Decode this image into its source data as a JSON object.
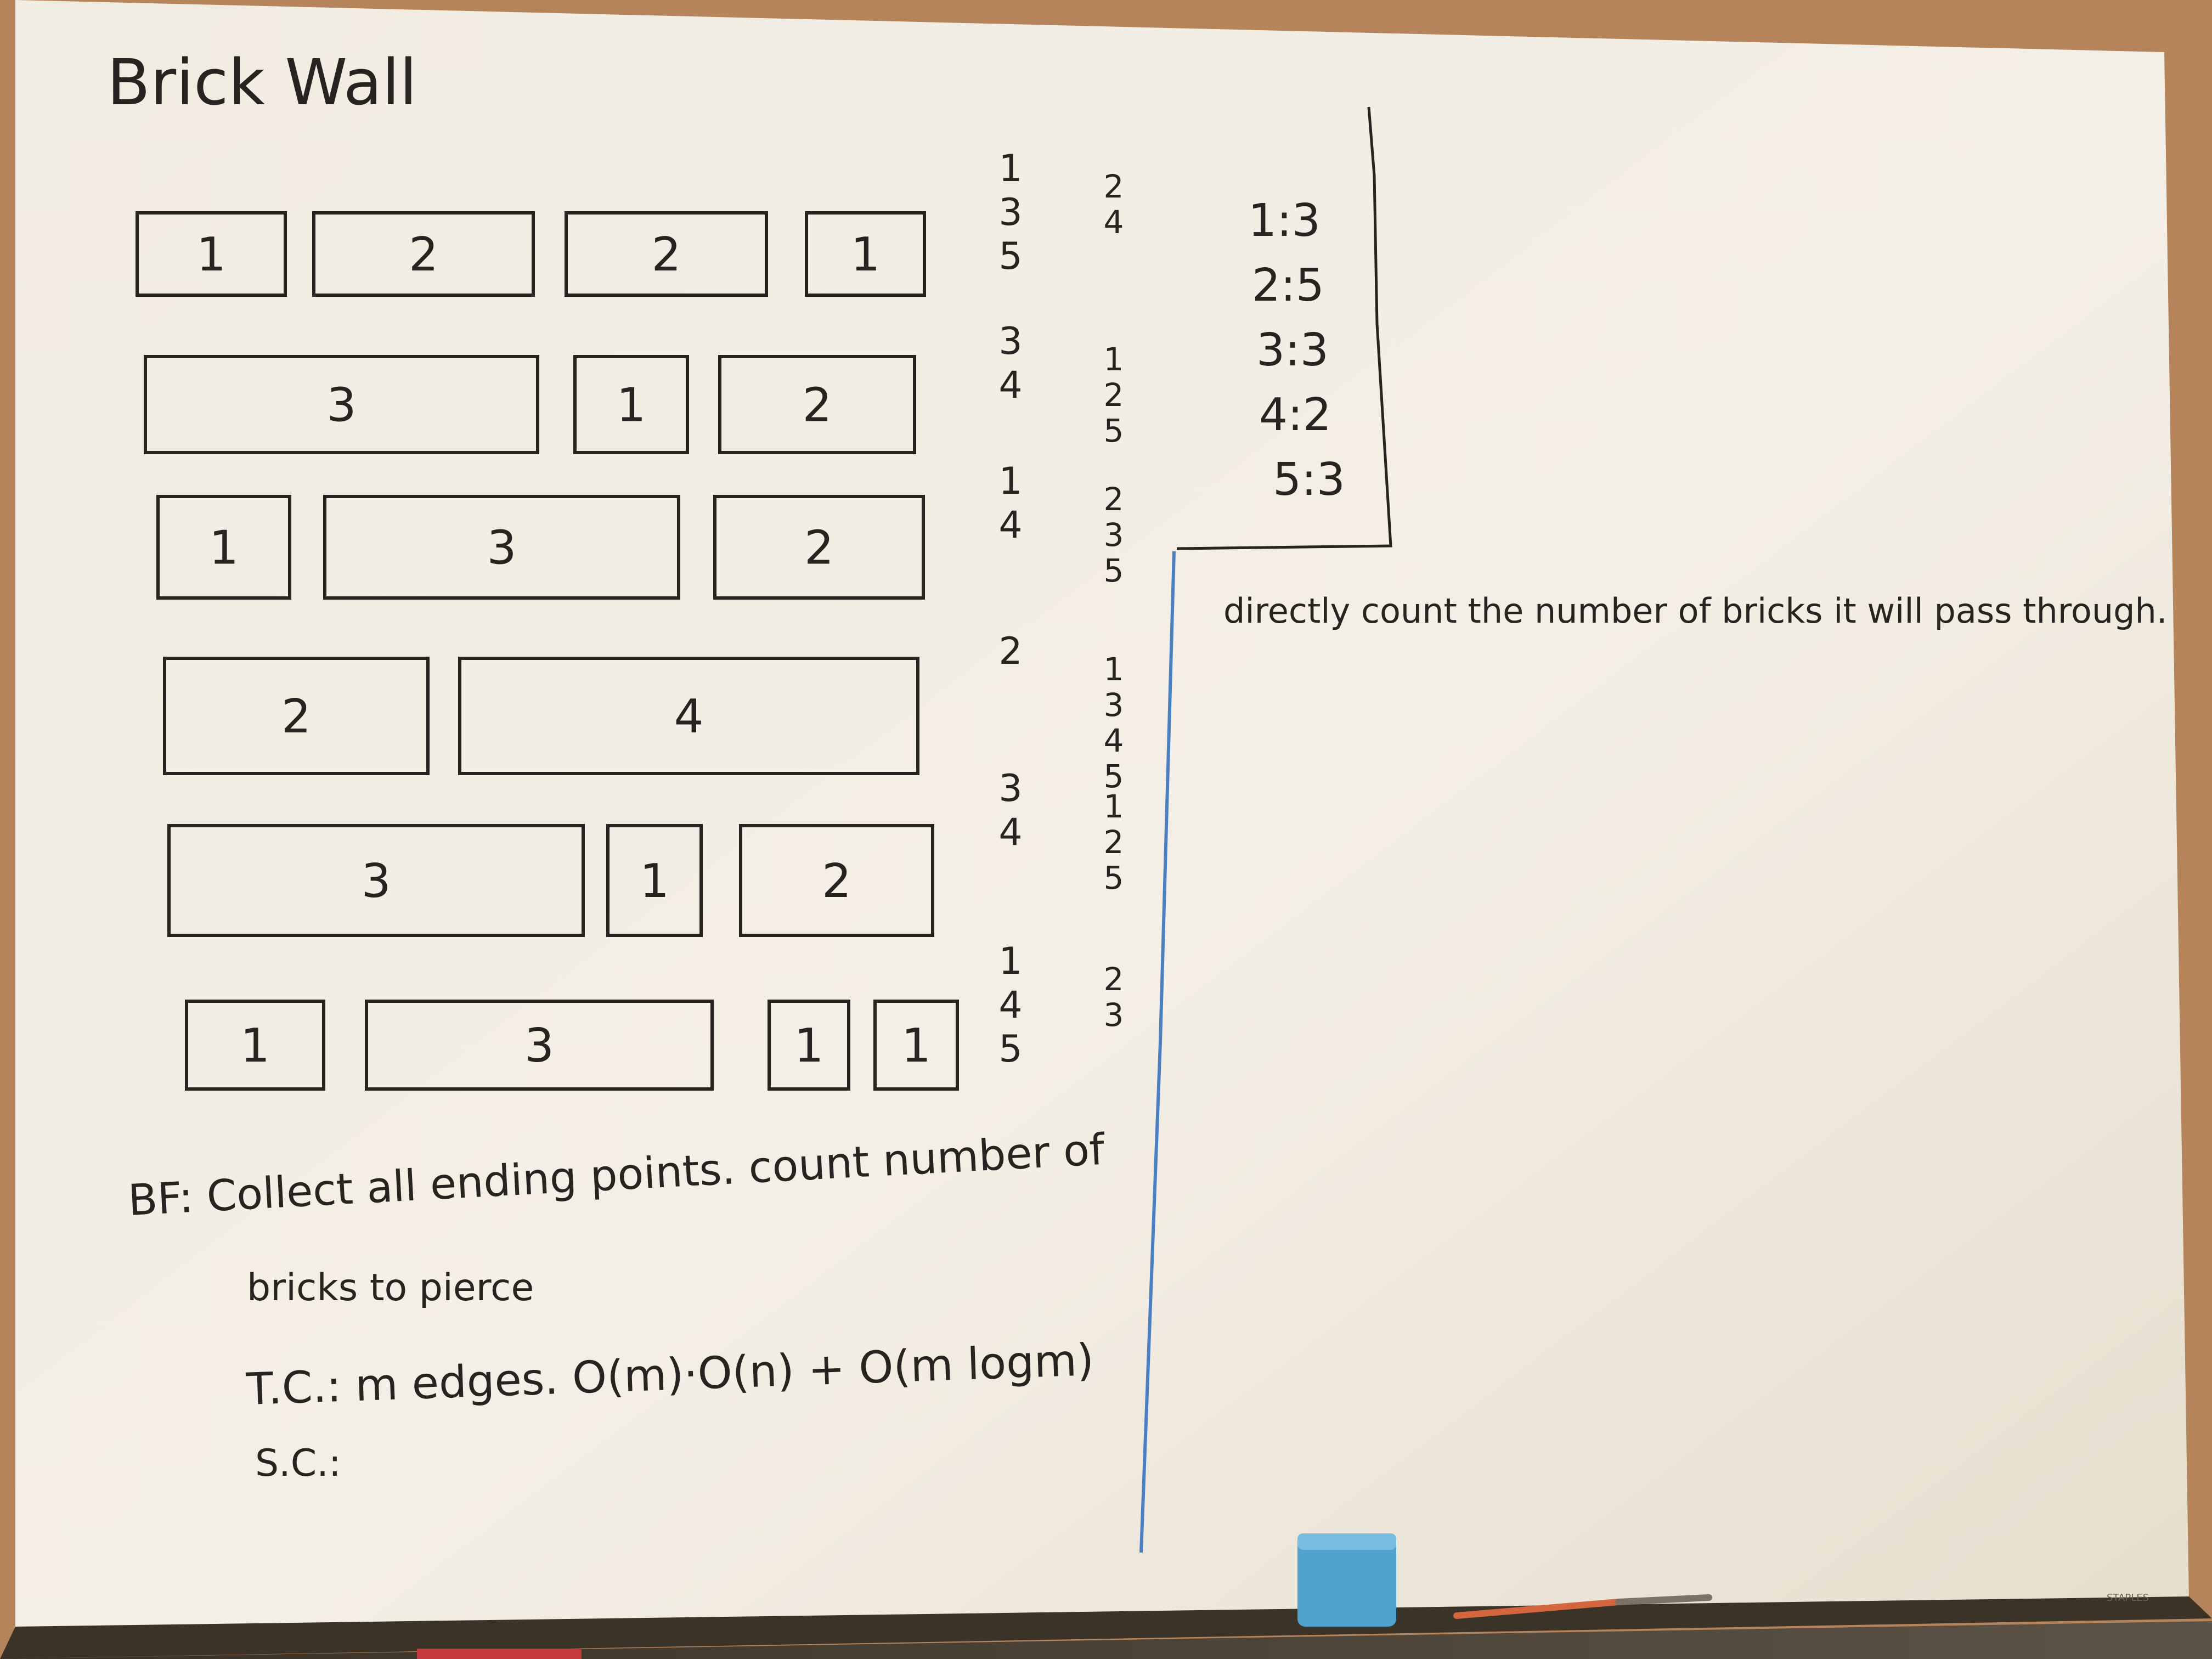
{
  "board": {
    "title": "Brick Wall",
    "brand": "STAPLES",
    "colors": {
      "surface": "#f4efe5",
      "frame": "#b5845a",
      "marker": "#262320",
      "divider": "#4a7fc4",
      "eraser": "#4fa3cf",
      "pencil": "#d4663f"
    }
  },
  "wall": {
    "rows": [
      {
        "bricks": [
          "1",
          "2",
          "2",
          "1"
        ]
      },
      {
        "bricks": [
          "3",
          "1",
          "2"
        ]
      },
      {
        "bricks": [
          "1",
          "3",
          "2"
        ]
      },
      {
        "bricks": [
          "2",
          "4"
        ]
      },
      {
        "bricks": [
          "3",
          "1",
          "2"
        ]
      },
      {
        "bricks": [
          "1",
          "3",
          "1",
          "1"
        ]
      }
    ]
  },
  "edges": {
    "rows": [
      {
        "left": [
          "1",
          "3",
          "5"
        ],
        "right": [
          "2",
          "4"
        ]
      },
      {
        "left": [
          "3",
          "4"
        ],
        "right": [
          "1",
          "2",
          "5"
        ]
      },
      {
        "left": [
          "1",
          "4"
        ],
        "right": [
          "2",
          "3",
          "5"
        ]
      },
      {
        "left": [
          "2"
        ],
        "right": [
          "1",
          "3",
          "4",
          "5"
        ]
      },
      {
        "left": [
          "3",
          "4"
        ],
        "right": [
          "1",
          "2",
          "5"
        ]
      },
      {
        "left": [
          "1",
          "4",
          "5"
        ],
        "right": [
          "2",
          "3"
        ]
      }
    ]
  },
  "counts": [
    "1:3",
    "2:5",
    "3:3",
    "4:2",
    "5:3"
  ],
  "note": "directly count the number of bricks it will pass through.",
  "analysis": {
    "bf_line1": "BF: Collect all ending points. count number of",
    "bf_line2": "bricks to pierce",
    "tc": "T.C.: m edges. O(m)·O(n) + O(m logm)",
    "sc": "S.C.:"
  }
}
